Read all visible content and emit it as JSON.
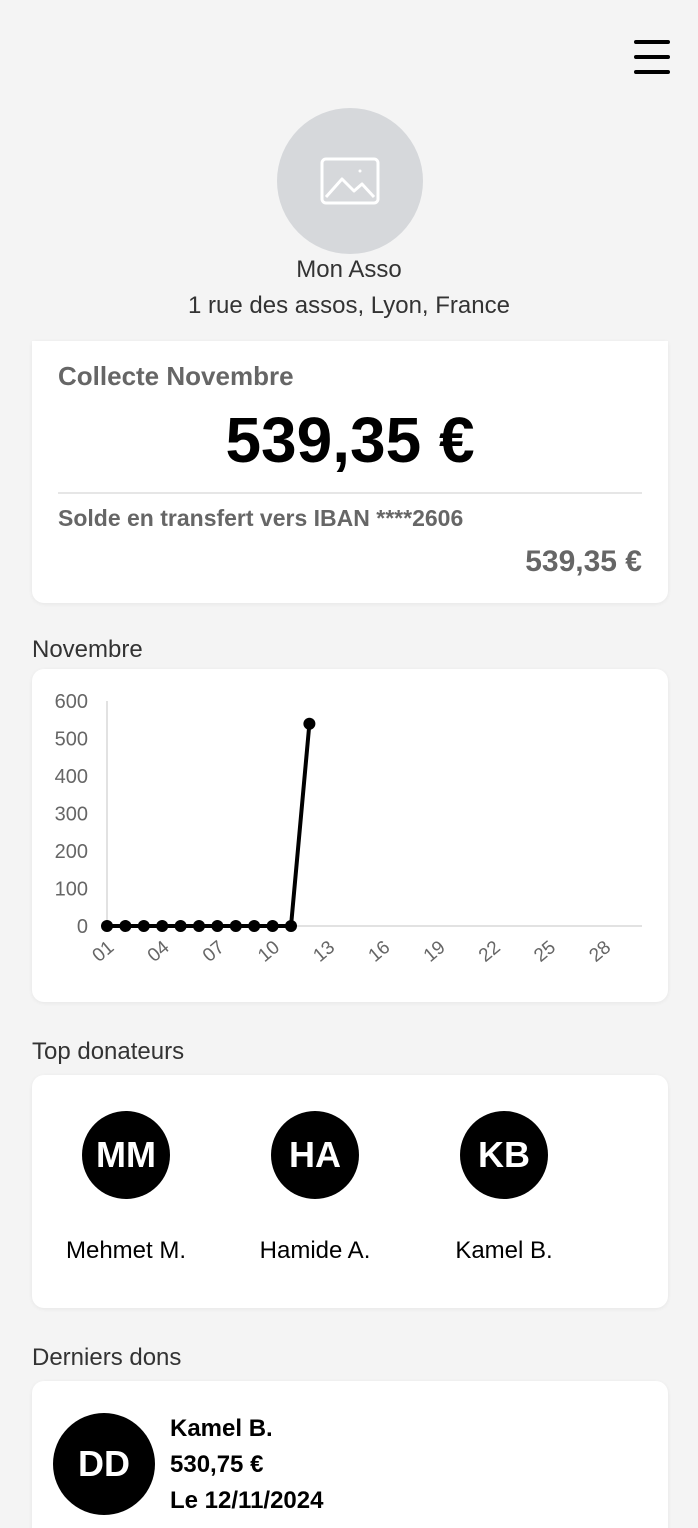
{
  "header": {
    "menu_icon": "hamburger-menu-icon"
  },
  "organization": {
    "logo_icon": "image-placeholder-icon",
    "name": "Mon Asso",
    "address": "1 rue des assos, Lyon, France"
  },
  "collect": {
    "title": "Collecte Novembre",
    "amount": "539,35 €",
    "transfer_label": "Solde en transfert vers IBAN ****2606",
    "transfer_amount": "539,35 €"
  },
  "chart_section": {
    "label": "Novembre"
  },
  "chart_data": {
    "type": "line",
    "y_ticks": [
      "0",
      "100",
      "200",
      "300",
      "400",
      "500",
      "600"
    ],
    "ylim": [
      0,
      600
    ],
    "x_tick_labels": [
      "01",
      "04",
      "07",
      "10",
      "13",
      "16",
      "19",
      "22",
      "25",
      "28"
    ],
    "xlim": [
      1,
      30
    ],
    "series": [
      {
        "color": "#000000",
        "x": [
          1,
          2,
          3,
          4,
          5,
          6,
          7,
          8,
          9,
          10,
          11,
          12
        ],
        "y": [
          0,
          0,
          0,
          0,
          0,
          0,
          0,
          0,
          0,
          0,
          0,
          539.35
        ]
      }
    ]
  },
  "top_donors": {
    "label": "Top donateurs",
    "items": [
      {
        "initials": "MM",
        "name": "Mehmet M."
      },
      {
        "initials": "HA",
        "name": "Hamide A."
      },
      {
        "initials": "KB",
        "name": "Kamel B."
      }
    ]
  },
  "last_donations": {
    "label": "Derniers dons",
    "items": [
      {
        "initials": "DD",
        "name": "Kamel B.",
        "amount": "530,75 €",
        "date": "Le 12/11/2024"
      }
    ]
  }
}
